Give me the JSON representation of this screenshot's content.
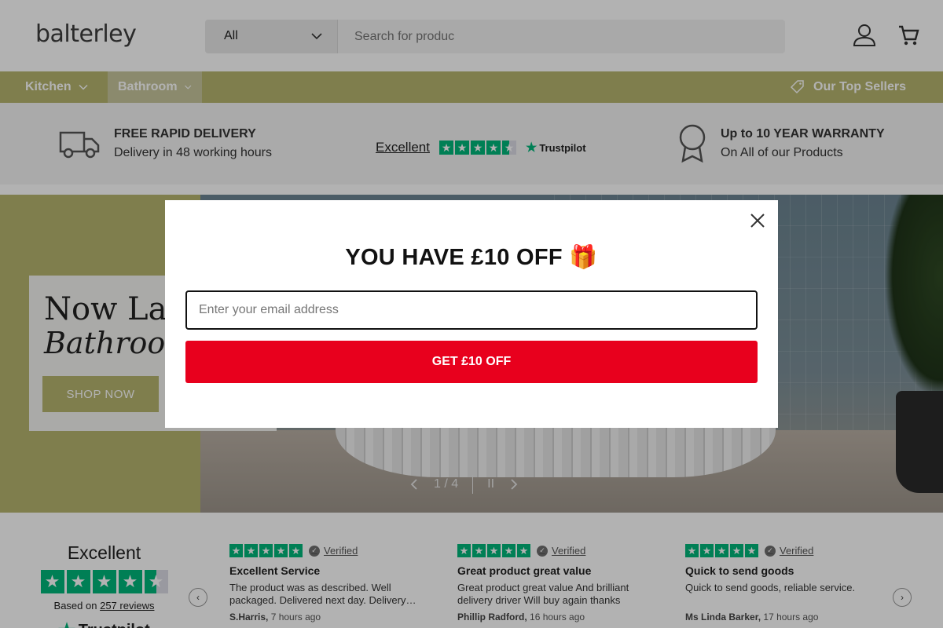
{
  "header": {
    "logo_text": "balterley",
    "search_category": "All",
    "search_placeholder": "Search for produc"
  },
  "nav": {
    "items": [
      {
        "label": "Kitchen"
      },
      {
        "label": "Bathroom"
      }
    ],
    "top_sellers": "Our Top Sellers"
  },
  "usp": {
    "delivery_title": "FREE RAPID DELIVERY",
    "delivery_sub": "Delivery in 48 working hours",
    "trustpilot_label": "Excellent",
    "trustpilot_brand": "Trustpilot",
    "warranty_title": "Up to 10 YEAR WARRANTY",
    "warranty_sub": "On All of our Products"
  },
  "hero": {
    "heading": "Now Laun",
    "subheading": "Bathroom",
    "button": "SHOP NOW",
    "slide_counter": "1 / 4",
    "pause": "II"
  },
  "modal": {
    "title": "YOU HAVE £10 OFF 🎁",
    "email_placeholder": "Enter your email address",
    "cta": "GET £10 OFF"
  },
  "reviews_summary": {
    "rating_word": "Excellent",
    "based_on_prefix": "Based on",
    "review_count": "257 reviews",
    "brand": "Trustpilot"
  },
  "reviews": [
    {
      "verified": "Verified",
      "title": "Excellent Service",
      "body": "The product was as described. Well packaged. Delivered next day. Delivery…",
      "author": "S.Harris,",
      "time": "7 hours ago"
    },
    {
      "verified": "Verified",
      "title": "Great product great value",
      "body": "Great product great value And brilliant delivery driver Will buy again thanks",
      "author": "Phillip Radford,",
      "time": "16 hours ago"
    },
    {
      "verified": "Verified",
      "title": "Quick to send goods",
      "body": "Quick to send goods, reliable service.",
      "author": "Ms Linda Barker,",
      "time": "17 hours ago"
    }
  ],
  "colors": {
    "brand_olive": "#b6b56f",
    "trustpilot_green": "#00b67a",
    "cta_red": "#e8001d"
  }
}
